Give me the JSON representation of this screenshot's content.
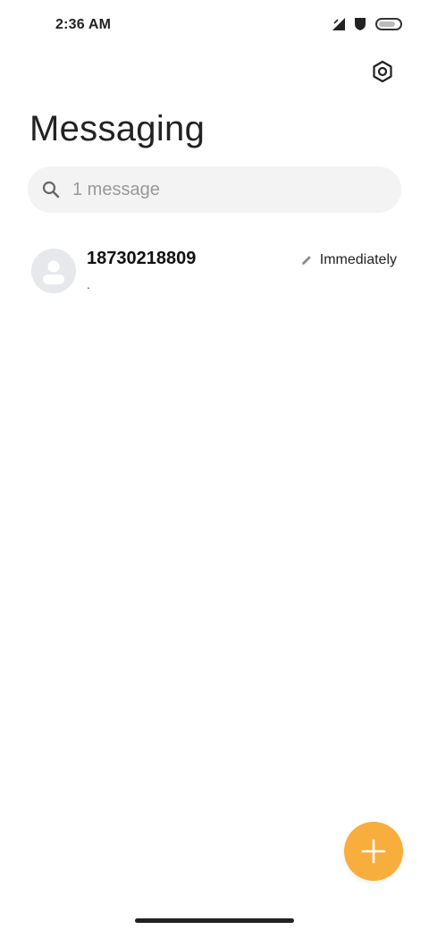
{
  "status_bar": {
    "time": "2:36 AM",
    "icons": [
      "signal-icon",
      "shield-icon",
      "battery-icon"
    ]
  },
  "header": {
    "title": "Messaging",
    "settings_icon": "settings-icon"
  },
  "search": {
    "placeholder": "1 message",
    "value": ""
  },
  "conversations": [
    {
      "name": "18730218809",
      "snippet": ".",
      "time": "Immediately",
      "status_icon": "draft-pencil-icon"
    }
  ],
  "fab": {
    "icon": "plus-icon",
    "color": "#f8ae3d"
  }
}
